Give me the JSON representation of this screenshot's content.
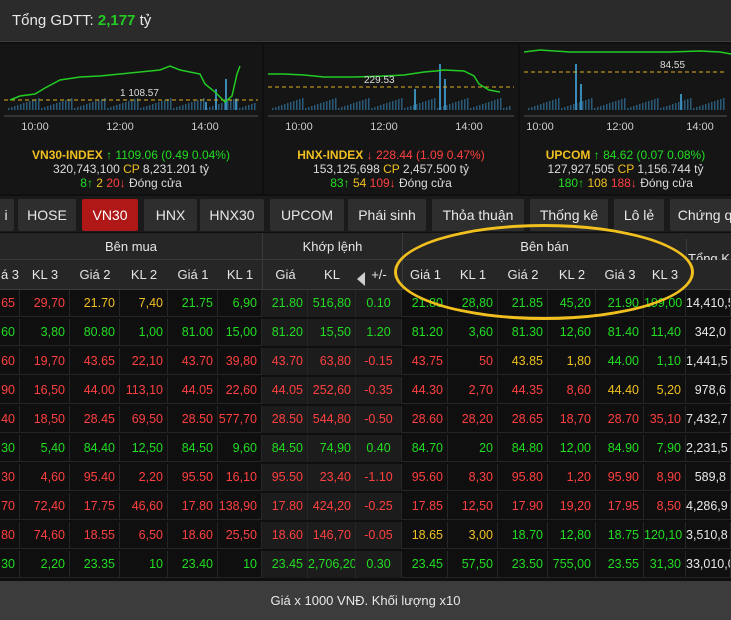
{
  "header": {
    "label": "Tổng GDTT:",
    "value": "2,177",
    "unit": "tỷ"
  },
  "indices": [
    {
      "name": "VN30-INDEX",
      "arrow": "↑",
      "value": "1109.06",
      "change": "(0.49  0.04%)",
      "volume": "320,743,100",
      "cp_label": "CP",
      "value2": "8,231.201",
      "unit": "tỷ",
      "up": "8",
      "same": "2",
      "down": "20",
      "status": "Đóng cửa",
      "ref_label": "1 108.57",
      "times": [
        "10:00",
        "12:00",
        "14:00"
      ],
      "color": "#22dd22"
    },
    {
      "name": "HNX-INDEX",
      "arrow": "↓",
      "value": "228.44",
      "change": "(1.09  0.47%)",
      "volume": "153,125,698",
      "cp_label": "CP",
      "value2": "2,457.500",
      "unit": "tỷ",
      "up": "83",
      "same": "54",
      "down": "109",
      "status": "Đóng cửa",
      "ref_label": "229.53",
      "times": [
        "10:00",
        "12:00",
        "14:00"
      ],
      "color": "#ff4040"
    },
    {
      "name": "UPCOM",
      "arrow": "↑",
      "value": "84.62",
      "change": "(0.07  0.08%)",
      "volume": "127,927,505",
      "cp_label": "CP",
      "value2": "1,156.744",
      "unit": "tỷ",
      "up": "180",
      "same": "108",
      "down": "188",
      "status": "Đóng cửa",
      "ref_label": "84.55",
      "times": [
        "10:00",
        "12:00",
        "14:00"
      ],
      "color": "#22dd22"
    }
  ],
  "tabs": [
    "i",
    "HOSE",
    "VN30",
    "HNX",
    "HNX30",
    "UPCOM",
    "Phái sinh",
    "Thỏa thuận",
    "Thống kê",
    "Lô lẻ",
    "Chứng q"
  ],
  "active_tab": "VN30",
  "table": {
    "group_headers": {
      "buy": "Bên mua",
      "match": "Khớp lệnh",
      "sell": "Bên bán",
      "total": "Tổng K"
    },
    "columns": [
      "á 3",
      "KL 3",
      "Giá 2",
      "KL 2",
      "Giá 1",
      "KL 1",
      "Giá",
      "KL",
      "+/-",
      "Giá 1",
      "KL 1",
      "Giá 2",
      "KL 2",
      "Giá 3",
      "KL 3"
    ],
    "rows": [
      {
        "v": [
          "65",
          "29,70",
          "21.70",
          "7,40",
          "21.75",
          "6,90",
          "21.80",
          "516,80",
          "0.10",
          "21.80",
          "28,80",
          "21.85",
          "45,20",
          "21.90",
          "199,00",
          "14,410,5"
        ],
        "c": [
          "r",
          "r",
          "y",
          "y",
          "g",
          "g",
          "g",
          "g",
          "g",
          "g",
          "g",
          "g",
          "g",
          "g",
          "g",
          "w"
        ]
      },
      {
        "v": [
          "60",
          "3,80",
          "80.80",
          "1,00",
          "81.00",
          "15,00",
          "81.20",
          "15,50",
          "1.20",
          "81.20",
          "3,60",
          "81.30",
          "12,60",
          "81.40",
          "11,40",
          "342,0"
        ],
        "c": [
          "g",
          "g",
          "g",
          "g",
          "g",
          "g",
          "g",
          "g",
          "g",
          "g",
          "g",
          "g",
          "g",
          "g",
          "g",
          "w"
        ]
      },
      {
        "v": [
          "60",
          "19,70",
          "43.65",
          "22,10",
          "43.70",
          "39,80",
          "43.70",
          "63,80",
          "-0.15",
          "43.75",
          "50",
          "43.85",
          "1,80",
          "44.00",
          "1,10",
          "1,441,5"
        ],
        "c": [
          "r",
          "r",
          "r",
          "r",
          "r",
          "r",
          "r",
          "r",
          "r",
          "r",
          "r",
          "y",
          "y",
          "g",
          "g",
          "w"
        ]
      },
      {
        "v": [
          "90",
          "16,50",
          "44.00",
          "113,10",
          "44.05",
          "22,60",
          "44.05",
          "252,60",
          "-0.35",
          "44.30",
          "2,70",
          "44.35",
          "8,60",
          "44.40",
          "5,20",
          "978,6"
        ],
        "c": [
          "r",
          "r",
          "r",
          "r",
          "r",
          "r",
          "r",
          "r",
          "r",
          "r",
          "r",
          "r",
          "r",
          "y",
          "y",
          "w"
        ]
      },
      {
        "v": [
          "40",
          "18,50",
          "28.45",
          "69,50",
          "28.50",
          "577,70",
          "28.50",
          "544,80",
          "-0.50",
          "28.60",
          "28,20",
          "28.65",
          "18,70",
          "28.70",
          "35,10",
          "7,432,7"
        ],
        "c": [
          "r",
          "r",
          "r",
          "r",
          "r",
          "r",
          "r",
          "r",
          "r",
          "r",
          "r",
          "r",
          "r",
          "r",
          "r",
          "w"
        ]
      },
      {
        "v": [
          "30",
          "5,40",
          "84.40",
          "12,50",
          "84.50",
          "9,60",
          "84.50",
          "74,90",
          "0.40",
          "84.70",
          "20",
          "84.80",
          "12,00",
          "84.90",
          "7,90",
          "2,231,5"
        ],
        "c": [
          "g",
          "g",
          "g",
          "g",
          "g",
          "g",
          "g",
          "g",
          "g",
          "g",
          "g",
          "g",
          "g",
          "g",
          "g",
          "w"
        ]
      },
      {
        "v": [
          "30",
          "4,60",
          "95.40",
          "2,20",
          "95.50",
          "16,10",
          "95.50",
          "23,40",
          "-1.10",
          "95.60",
          "8,30",
          "95.80",
          "1,20",
          "95.90",
          "8,90",
          "589,8"
        ],
        "c": [
          "r",
          "r",
          "r",
          "r",
          "r",
          "r",
          "r",
          "r",
          "r",
          "r",
          "r",
          "r",
          "r",
          "r",
          "r",
          "w"
        ]
      },
      {
        "v": [
          "70",
          "72,40",
          "17.75",
          "46,60",
          "17.80",
          "138,90",
          "17.80",
          "424,20",
          "-0.25",
          "17.85",
          "12,50",
          "17.90",
          "19,20",
          "17.95",
          "8,50",
          "4,286,9"
        ],
        "c": [
          "r",
          "r",
          "r",
          "r",
          "r",
          "r",
          "r",
          "r",
          "r",
          "r",
          "r",
          "r",
          "r",
          "r",
          "r",
          "w"
        ]
      },
      {
        "v": [
          "80",
          "74,60",
          "18.55",
          "6,50",
          "18.60",
          "25,50",
          "18.60",
          "146,70",
          "-0.05",
          "18.65",
          "3,00",
          "18.70",
          "12,80",
          "18.75",
          "120,10",
          "3,510,8"
        ],
        "c": [
          "r",
          "r",
          "r",
          "r",
          "r",
          "r",
          "r",
          "r",
          "r",
          "y",
          "y",
          "g",
          "g",
          "g",
          "g",
          "w"
        ]
      },
      {
        "v": [
          "30",
          "2,20",
          "23.35",
          "10",
          "23.40",
          "10",
          "23.45",
          "2,706,20",
          "0.30",
          "23.45",
          "57,50",
          "23.50",
          "755,00",
          "23.55",
          "31,30",
          "33,010,0"
        ],
        "c": [
          "g",
          "g",
          "g",
          "g",
          "g",
          "g",
          "g",
          "g",
          "g",
          "g",
          "g",
          "g",
          "g",
          "g",
          "g",
          "w"
        ]
      }
    ]
  },
  "footer": "Giá x 1000 VNĐ. Khối lượng x10"
}
